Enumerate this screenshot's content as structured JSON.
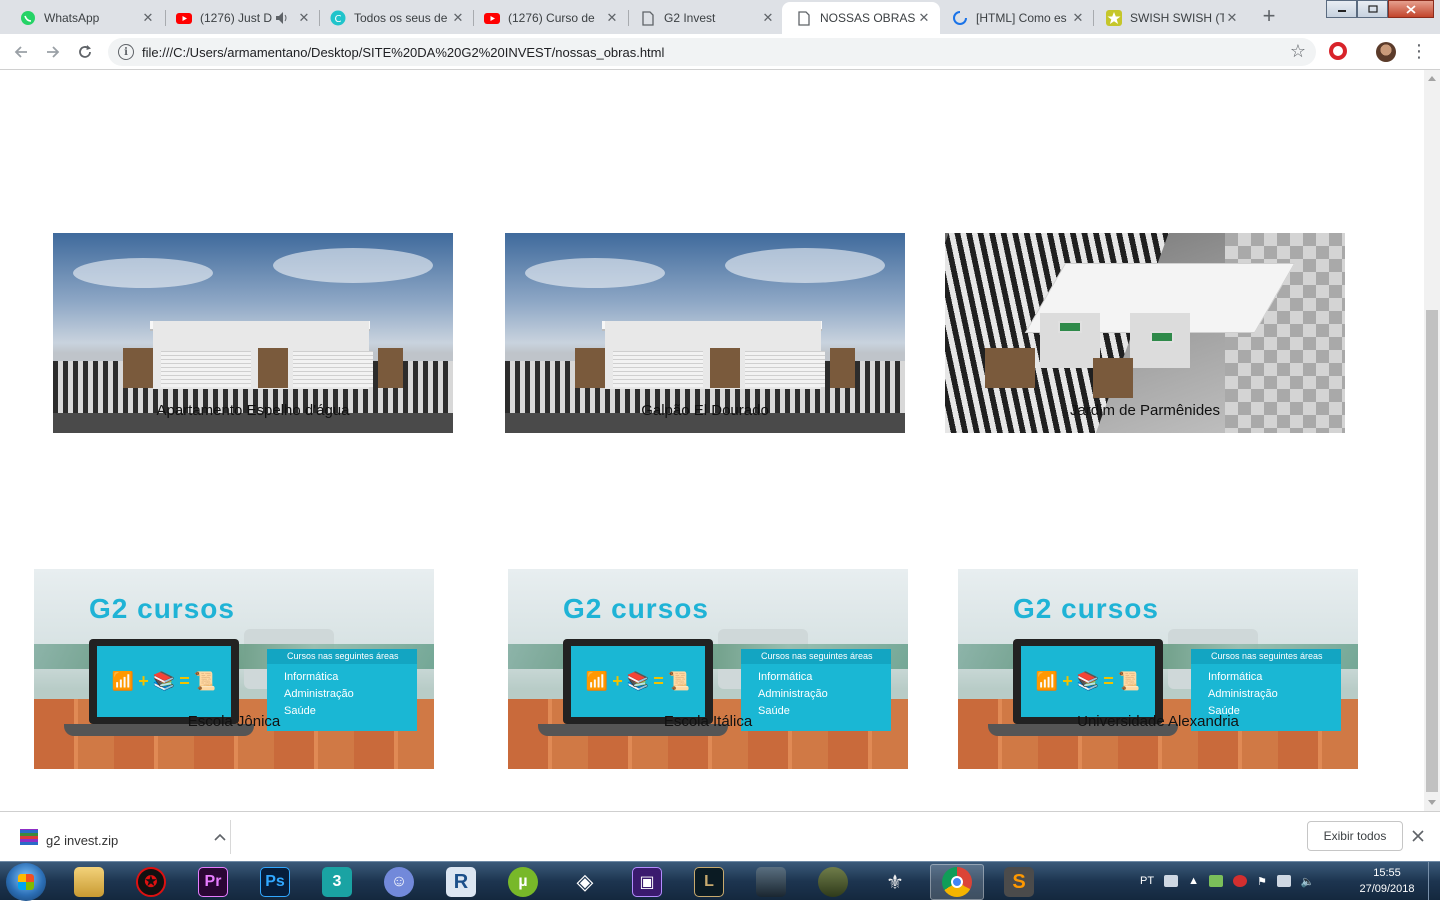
{
  "browser": {
    "tabs": [
      {
        "title": "WhatsApp",
        "icon": "whatsapp-icon",
        "active": false
      },
      {
        "title": "(1276) Just D",
        "icon": "youtube-icon",
        "active": false,
        "audio": true
      },
      {
        "title": "Todos os seus de",
        "icon": "canva-icon",
        "active": false
      },
      {
        "title": "(1276) Curso de",
        "icon": "youtube-icon",
        "active": false
      },
      {
        "title": "G2 Invest",
        "icon": "page-icon",
        "active": false
      },
      {
        "title": "NOSSAS OBRAS",
        "icon": "page-icon",
        "active": true
      },
      {
        "title": "[HTML] Como es",
        "icon": "loading-icon",
        "active": false
      },
      {
        "title": "SWISH SWISH (T",
        "icon": "star-favicon-icon",
        "active": false
      }
    ],
    "close_glyph": "✕",
    "new_tab_glyph": "+",
    "url": "file:///C:/Users/armamentano/Desktop/SITE%20DA%20G2%20INVEST/nossas_obras.html",
    "bookmark_glyph": "☆",
    "menu_glyph": "⋮"
  },
  "page": {
    "obras": [
      {
        "caption": "Apartamento Espelho d'água",
        "image": "house-render-front"
      },
      {
        "caption": "Galpão El Dourado",
        "image": "house-render-front"
      },
      {
        "caption": "Jardim de Parmênides",
        "image": "house-render-perspective"
      }
    ],
    "cursos": [
      {
        "caption": "Escola Jônica",
        "image": "g2-cursos-banner"
      },
      {
        "caption": "Escola Itálica",
        "image": "g2-cursos-banner"
      },
      {
        "caption": "Universidade Alexandria",
        "image": "g2-cursos-banner"
      }
    ],
    "banner": {
      "title": "G2 cursos",
      "panel_header": "Cursos nas seguintes áreas",
      "areas": [
        "Informática",
        "Administração",
        "Saúde"
      ]
    }
  },
  "downloads": {
    "file_name": "g2 invest.zip",
    "show_all_label": "Exibir todos"
  },
  "taskbar": {
    "apps": [
      "gaming-app-icon",
      "premiere-icon",
      "photoshop-icon",
      "3dsmax-icon",
      "discord-icon",
      "revit-icon",
      "utorrent-icon",
      "gamemaker-icon",
      "cpu-app-icon",
      "league-of-legends-icon",
      "game-icon",
      "halo-icon",
      "skyrim-icon",
      "chrome-icon",
      "sublime-text-icon"
    ],
    "language": "PT",
    "time": "15:55",
    "date": "27/09/2018"
  }
}
